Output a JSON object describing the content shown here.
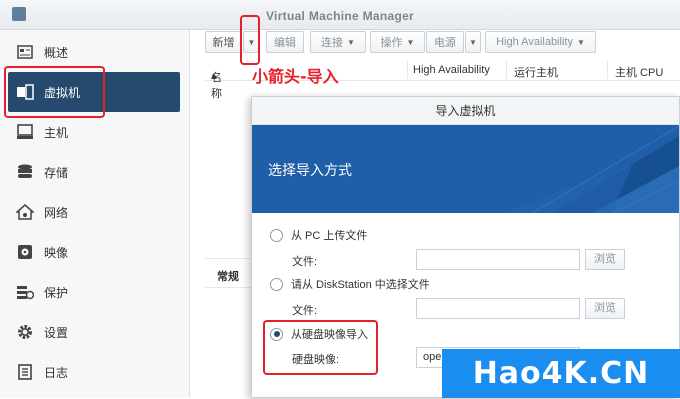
{
  "window": {
    "title": "Virtual Machine Manager",
    "icon": "dsm-app-icon"
  },
  "sidebar": {
    "items": [
      {
        "label": "概述",
        "icon": "overview-icon"
      },
      {
        "label": "虚拟机",
        "icon": "virtual-machine-icon",
        "active": true
      },
      {
        "label": "主机",
        "icon": "host-icon"
      },
      {
        "label": "存储",
        "icon": "storage-icon"
      },
      {
        "label": "网络",
        "icon": "network-icon"
      },
      {
        "label": "映像",
        "icon": "image-icon"
      },
      {
        "label": "保护",
        "icon": "protection-icon"
      },
      {
        "label": "设置",
        "icon": "gear-icon"
      },
      {
        "label": "日志",
        "icon": "log-icon"
      }
    ]
  },
  "toolbar": {
    "create": "新增",
    "edit": "编辑",
    "connect": "连接",
    "action": "操作",
    "power": "电源",
    "high_availability": "High Availability"
  },
  "annotation": {
    "text": "小箭头-导入"
  },
  "grid": {
    "columns": [
      "名称",
      "High Availability",
      "运行主机",
      "主机 CPU"
    ],
    "sort_indicator": "▴"
  },
  "lower_panel": {
    "tab": "常规"
  },
  "dialog": {
    "title": "导入虚拟机",
    "heading": "选择导入方式",
    "options": [
      {
        "label": "从 PC 上传文件",
        "checked": false,
        "field_label": "文件:",
        "field_value": "",
        "browse": "浏览"
      },
      {
        "label": "请从 DiskStation 中选择文件",
        "checked": false,
        "field_label": "文件:",
        "field_value": "",
        "browse": "浏览"
      },
      {
        "label": "从硬盘映像导入",
        "checked": true,
        "field_label": "硬盘映像:",
        "field_value": "oper"
      }
    ]
  },
  "watermark": {
    "text": "Hao4K.CN"
  },
  "colors": {
    "accent": "#26496e",
    "banner": "#1f5ea8",
    "highlight": "#e8202a",
    "watermark": "#1a8df0"
  }
}
